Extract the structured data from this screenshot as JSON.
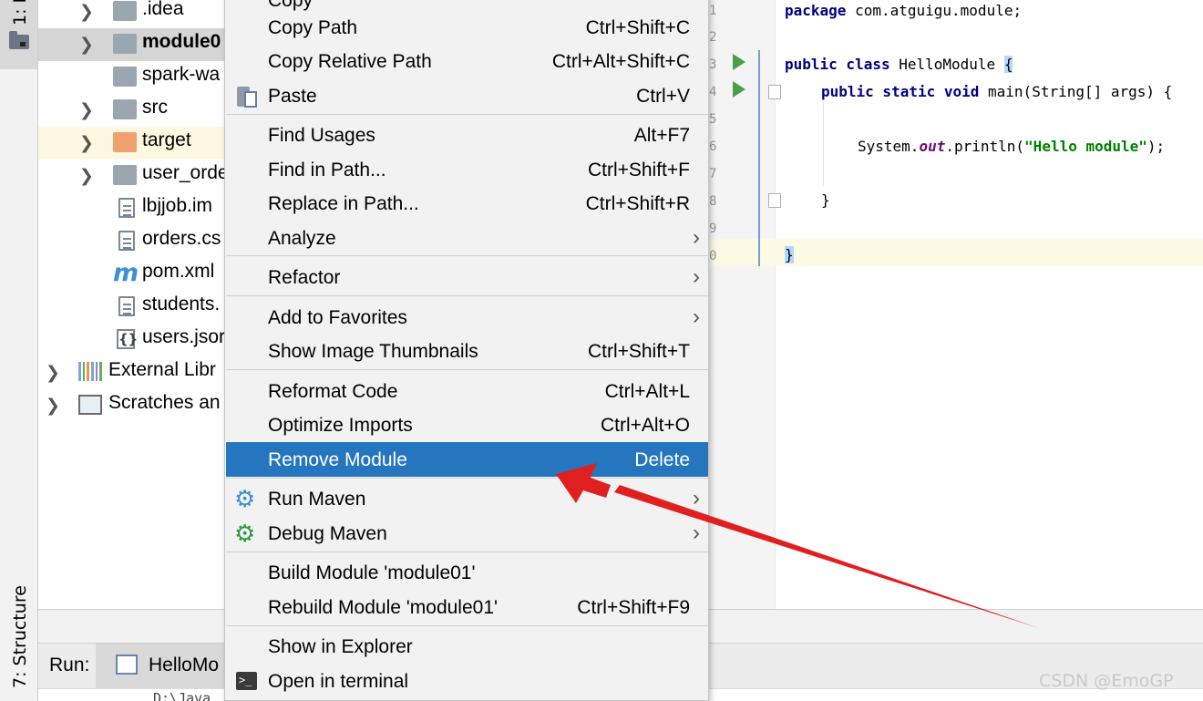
{
  "tool_windows": {
    "project_label": "1: P",
    "structure_label": "7: Structure"
  },
  "project_tree": {
    "items": [
      {
        "label": ".idea",
        "icon": "folder-icon"
      },
      {
        "label": "module0",
        "icon": "module-folder-icon",
        "selected": true
      },
      {
        "label": "spark-wa",
        "icon": "folder-icon"
      },
      {
        "label": "src",
        "icon": "folder-icon"
      },
      {
        "label": "target",
        "icon": "folder-orange-icon"
      },
      {
        "label": "user_orde",
        "icon": "folder-icon"
      },
      {
        "label": "lbjjob.im",
        "icon": "iml-file-icon"
      },
      {
        "label": "orders.cs",
        "icon": "text-file-icon"
      },
      {
        "label": "pom.xml",
        "icon": "maven-icon",
        "icon_glyph": "m"
      },
      {
        "label": "students.",
        "icon": "text-file-icon"
      },
      {
        "label": "users.jsor",
        "icon": "json-file-icon",
        "icon_glyph": "{}"
      },
      {
        "label": "External Libr",
        "icon": "library-icon"
      },
      {
        "label": "Scratches an",
        "icon": "scratches-icon"
      }
    ]
  },
  "context_menu": {
    "partial_top_label": "Copy",
    "items": [
      {
        "label": "Copy Path",
        "shortcut": "Ctrl+Shift+C"
      },
      {
        "label": "Copy Relative Path",
        "shortcut": "Ctrl+Alt+Shift+C"
      },
      {
        "label": "Paste",
        "shortcut": "Ctrl+V"
      },
      {
        "label": "Find Usages",
        "shortcut": "Alt+F7"
      },
      {
        "label": "Find in Path...",
        "shortcut": "Ctrl+Shift+F"
      },
      {
        "label": "Replace in Path...",
        "shortcut": "Ctrl+Shift+R"
      },
      {
        "label": "Analyze",
        "shortcut": ""
      },
      {
        "label": "Refactor",
        "shortcut": ""
      },
      {
        "label": "Add to Favorites",
        "shortcut": ""
      },
      {
        "label": "Show Image Thumbnails",
        "shortcut": "Ctrl+Shift+T"
      },
      {
        "label": "Reformat Code",
        "shortcut": "Ctrl+Alt+L"
      },
      {
        "label": "Optimize Imports",
        "shortcut": "Ctrl+Alt+O"
      },
      {
        "label": "Remove Module",
        "shortcut": "Delete",
        "active": true
      },
      {
        "label": "Run Maven",
        "shortcut": ""
      },
      {
        "label": "Debug Maven",
        "shortcut": ""
      },
      {
        "label": "Build Module 'module01'",
        "shortcut": ""
      },
      {
        "label": "Rebuild Module 'module01'",
        "shortcut": "Ctrl+Shift+F9"
      },
      {
        "label": "Show in Explorer",
        "shortcut": ""
      },
      {
        "label": "Open in terminal",
        "shortcut": ""
      }
    ]
  },
  "editor": {
    "line_numbers": [
      "1",
      "2",
      "3",
      "4",
      "5",
      "6",
      "7",
      "8",
      "9",
      "0"
    ],
    "code": {
      "l1_kw": "package",
      "l1_rest": " com.atguigu.module;",
      "l3_kw": "public class",
      "l3_name": " HelloModule ",
      "l3_brace": "{",
      "l4_kw": "public static void",
      "l4_rest": " main(String[] args) {",
      "l6_pre": "System.",
      "l6_field": "out",
      "l6_mid": ".println(",
      "l6_str": "\"Hello module\"",
      "l6_end": ");",
      "l8": "}",
      "l10": "}"
    }
  },
  "run_panel": {
    "label": "Run:",
    "tab_label": "HelloMo",
    "console_text": "D:\\Java"
  },
  "watermark": "CSDN @EmoGP",
  "colors": {
    "menu_active": "#2675bf",
    "annotation_arrow": "#e02020",
    "run_arrow": "#4aa04a"
  }
}
